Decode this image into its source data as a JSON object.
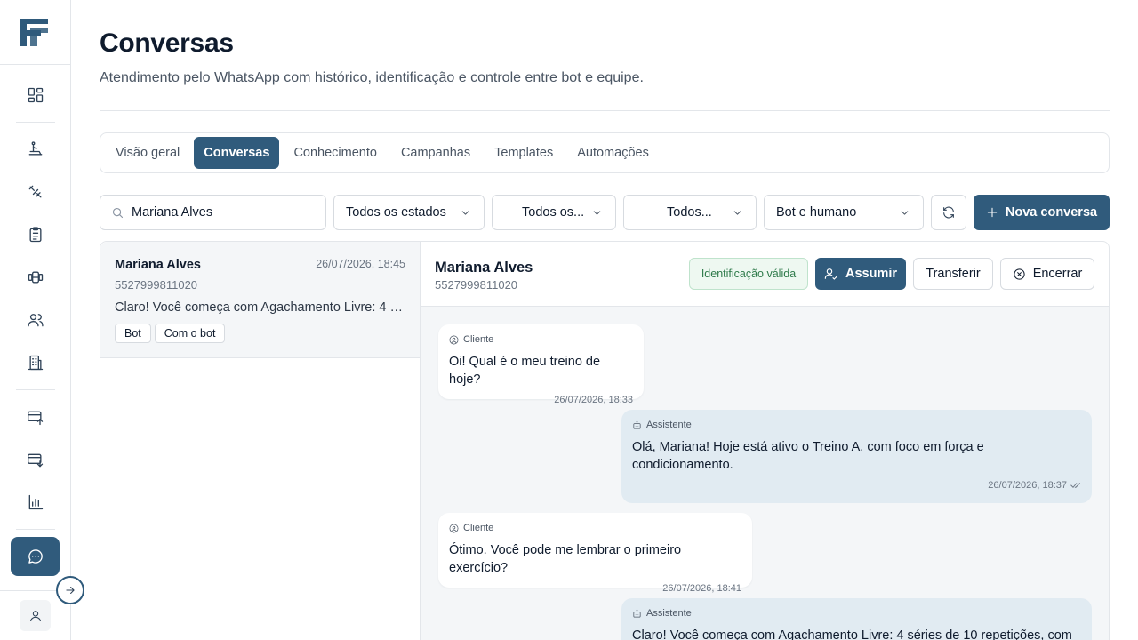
{
  "page": {
    "title": "Conversas",
    "subtitle": "Atendimento pelo WhatsApp com histórico, identificação e controle entre bot e equipe."
  },
  "tabs": [
    {
      "label": "Visão geral",
      "active": false
    },
    {
      "label": "Conversas",
      "active": true
    },
    {
      "label": "Conhecimento",
      "active": false
    },
    {
      "label": "Campanhas",
      "active": false
    },
    {
      "label": "Templates",
      "active": false
    },
    {
      "label": "Automações",
      "active": false
    }
  ],
  "filters": {
    "search_value": "Mariana Alves",
    "status_select": "Todos os estados",
    "select_2": "Todos os...",
    "select_3": "Todos...",
    "mode_select": "Bot e humano",
    "new_button": "Nova conversa"
  },
  "conversation_list": [
    {
      "name": "Mariana Alves",
      "time": "26/07/2026, 18:45",
      "phone": "5527999811020",
      "preview": "Claro! Você começa com Agachamento Livre: 4 séries de 10 repetições, com",
      "tags": [
        "Bot",
        "Com o bot"
      ]
    }
  ],
  "chat": {
    "name": "Mariana Alves",
    "phone": "5527999811020",
    "status_badge": "Identificação válida",
    "assume_label": "Assumir",
    "transfer_label": "Transferir",
    "close_label": "Encerrar",
    "messages": [
      {
        "role": "client",
        "sender": "Cliente",
        "text": "Oi! Qual é o meu treino de hoje?",
        "time": "26/07/2026, 18:33"
      },
      {
        "role": "bot",
        "sender": "Assistente",
        "text": "Olá, Mariana! Hoje está ativo o Treino A, com foco em força e condicionamento.",
        "time": "26/07/2026, 18:37"
      },
      {
        "role": "client",
        "sender": "Cliente",
        "text": "Ótimo. Você pode me lembrar o primeiro exercício?",
        "time": "26/07/2026, 18:41"
      },
      {
        "role": "bot",
        "sender": "Assistente",
        "text": "Claro! Você começa com Agachamento Livre: 4 séries de 10 repetições, com",
        "time": ""
      }
    ]
  },
  "colors": {
    "primary": "#305b7c",
    "valid_badge": "#2e7a4a",
    "bot_bubble": "#e1ebf2"
  },
  "icons": {
    "sidebar": [
      "dashboard-icon",
      "treadmill-icon",
      "tools-icon",
      "clipboard-icon",
      "dumbbell-icon",
      "users-icon",
      "building-icon",
      "card-upload-icon",
      "card-download-icon",
      "chart-icon",
      "chat-icon"
    ]
  }
}
